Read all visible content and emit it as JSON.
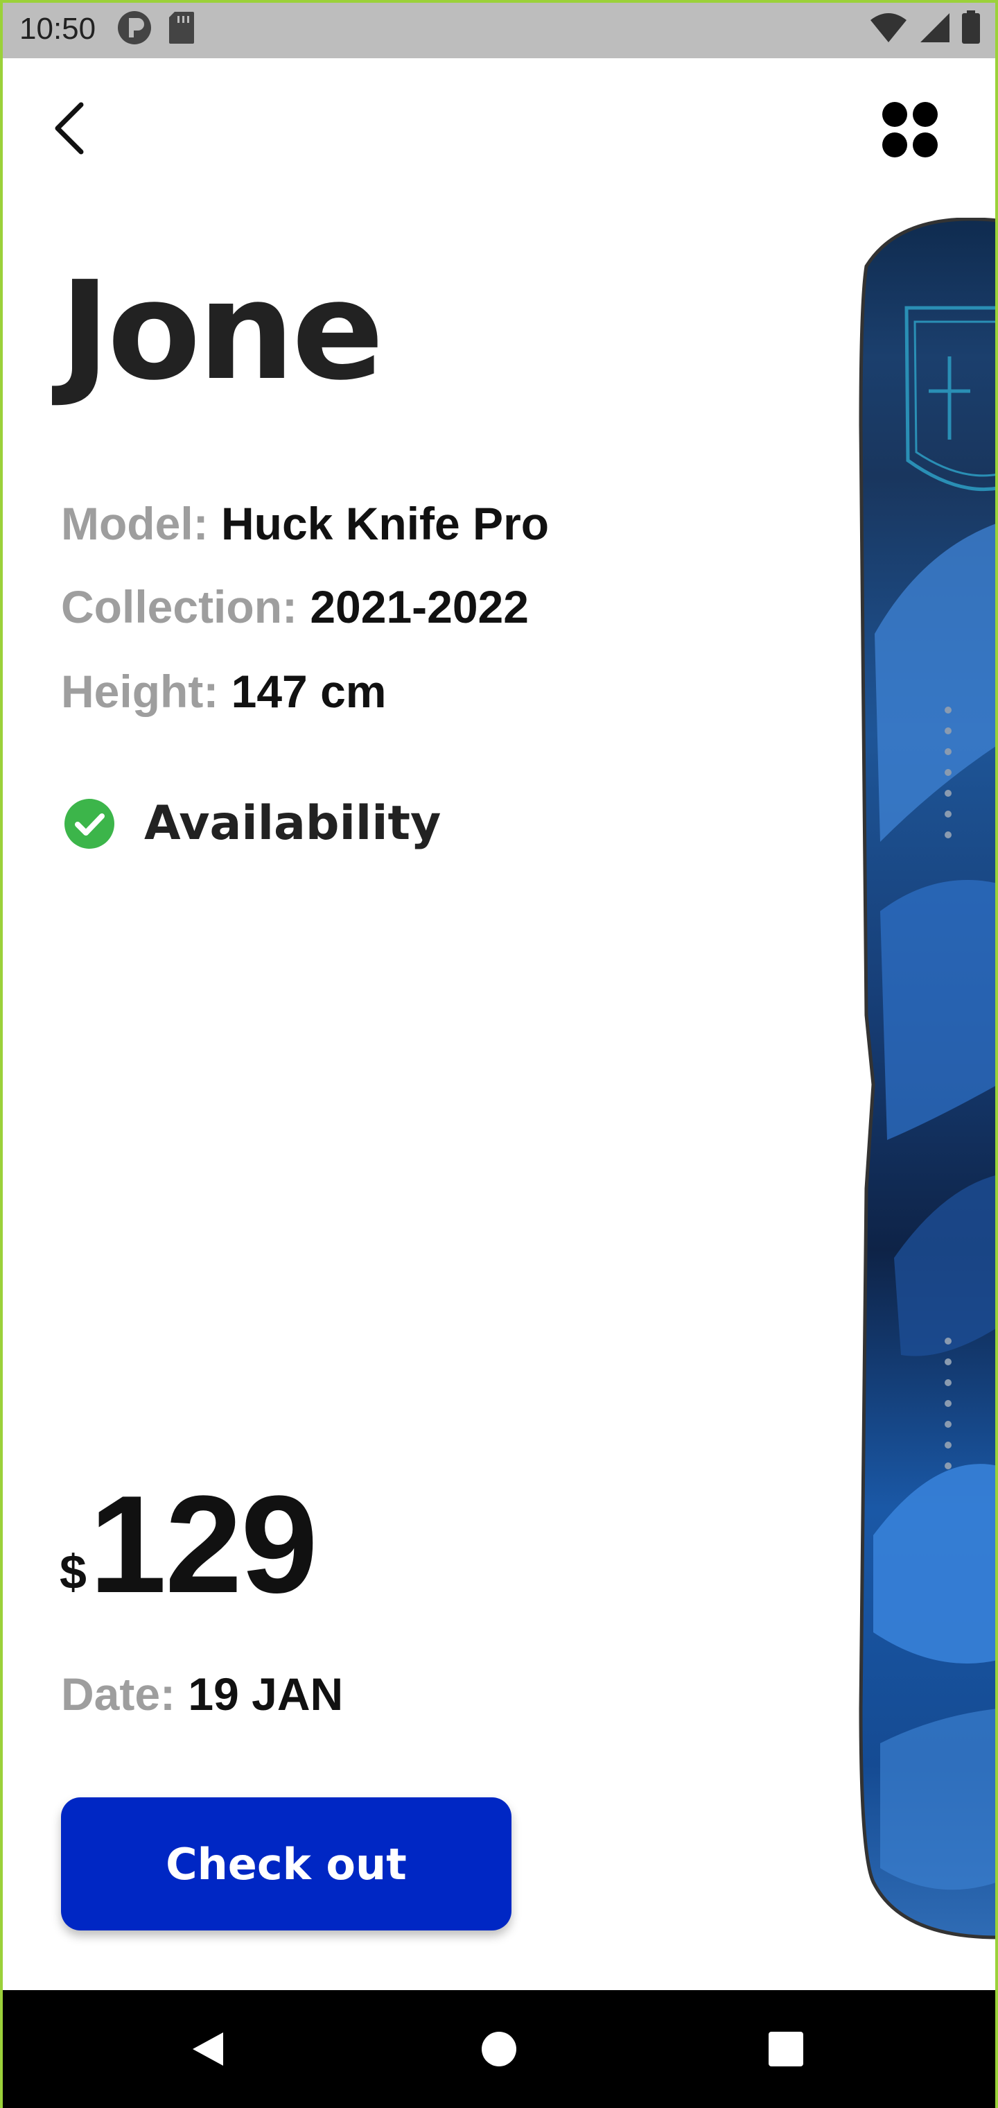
{
  "status_bar": {
    "time": "10:50",
    "icons": [
      "privacy-icon",
      "sd-card-icon",
      "wifi-icon",
      "signal-icon",
      "battery-icon"
    ]
  },
  "header": {
    "back_icon": "back-arrow-icon",
    "menu_icon": "four-dots-menu-icon"
  },
  "product": {
    "name": "Jone",
    "model_label": "Model:",
    "model_value": "Huck Knife Pro",
    "collection_label": "Collection:",
    "collection_value": "2021-2022",
    "height_label": "Height:",
    "height_value": "147 cm",
    "availability": "Availability",
    "price_currency": "$",
    "price_amount": "129",
    "date_label": "Date:",
    "date_value": "19 JAN"
  },
  "actions": {
    "checkout_label": "Check out"
  },
  "nav_bar": {
    "icons": [
      "back-triangle-icon",
      "home-circle-icon",
      "recents-square-icon"
    ]
  },
  "colors": {
    "accent": "#0027c4",
    "availability_green": "#3cb54a",
    "label_gray": "#9e9e9e",
    "status_bar": "#bdbdbd"
  }
}
